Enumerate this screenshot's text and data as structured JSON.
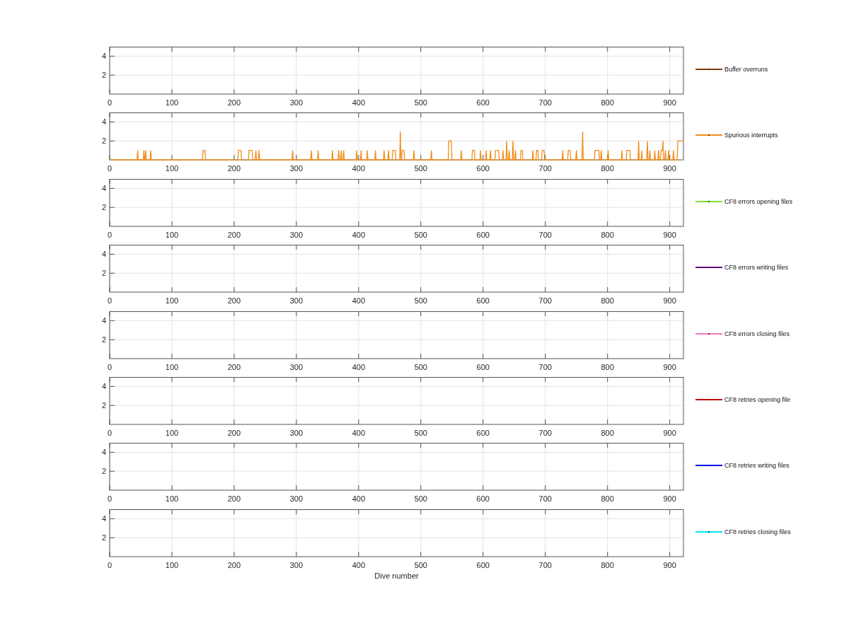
{
  "panels": [
    {
      "axes": {
        "grid": true,
        "x_tick_labels": [
          "0",
          "100",
          "200",
          "300",
          "400",
          "500",
          "600",
          "700",
          "800",
          "900"
        ],
        "y_tick_labels": [
          "4",
          "2"
        ],
        "legend": [
          {
            "label": "Buffer overruns",
            "color": "#8b3a0a"
          }
        ]
      }
    },
    {
      "chart_data": {
        "type": "line",
        "xlim": [
          0,
          922
        ],
        "ylim": [
          0,
          5
        ],
        "xticks": [
          0,
          100,
          200,
          300,
          400,
          500,
          600,
          700,
          800,
          900
        ],
        "yticks": [
          2,
          4
        ],
        "grid": true,
        "x": [
          0,
          44,
          45,
          46,
          54,
          55,
          56,
          57,
          58,
          59,
          65,
          66,
          67,
          149,
          150,
          153,
          154,
          206,
          207,
          211,
          212,
          223,
          224,
          229,
          230,
          234,
          235,
          236,
          239,
          240,
          241,
          293,
          294,
          295,
          323,
          324,
          325,
          334,
          335,
          336,
          357,
          358,
          359,
          367,
          368,
          369,
          371,
          372,
          373,
          375,
          376,
          377,
          396,
          397,
          398,
          403,
          404,
          405,
          413,
          414,
          415,
          426,
          427,
          428,
          440,
          441,
          442,
          447,
          448,
          449,
          454,
          455,
          459,
          460,
          466,
          467,
          468,
          469,
          470,
          473,
          474,
          488,
          489,
          490,
          516,
          517,
          518,
          544,
          545,
          549,
          550,
          564,
          565,
          566,
          582,
          583,
          586,
          587,
          595,
          596,
          597,
          604,
          605,
          606,
          611,
          612,
          613,
          619,
          620,
          625,
          626,
          631,
          632,
          633,
          637,
          638,
          639,
          641,
          642,
          643,
          647,
          648,
          649,
          651,
          652,
          653,
          660,
          661,
          663,
          664,
          679,
          680,
          681,
          685,
          686,
          688,
          689,
          694,
          695,
          698,
          699,
          727,
          728,
          729,
          736,
          737,
          740,
          741,
          749,
          750,
          751,
          759,
          760,
          761,
          779,
          780,
          786,
          787,
          789,
          790,
          791,
          800,
          801,
          802,
          822,
          823,
          824,
          830,
          831,
          836,
          837,
          849,
          850,
          851,
          854,
          855,
          856,
          863,
          864,
          865,
          867,
          868,
          869,
          875,
          876,
          877,
          881,
          882,
          883,
          885,
          886,
          888,
          889,
          890,
          892,
          893,
          894,
          897,
          898,
          899,
          905,
          906,
          907,
          912,
          913,
          922
        ],
        "series": [
          {
            "name": "Spurious interrupts",
            "color": "#f28e1c",
            "values": [
              0,
              0,
              1,
              0,
              0,
              1,
              0,
              0,
              1,
              0,
              0,
              1,
              0,
              0,
              1,
              1,
              0,
              0,
              1,
              1,
              0,
              0,
              1,
              1,
              0,
              0,
              1,
              0,
              0,
              1,
              0,
              0,
              1,
              0,
              0,
              1,
              0,
              0,
              1,
              0,
              0,
              1,
              0,
              0,
              1,
              0,
              0,
              1,
              0,
              0,
              1,
              0,
              0,
              1,
              0,
              0,
              1,
              0,
              0,
              1,
              0,
              0,
              1,
              0,
              0,
              1,
              0,
              0,
              1,
              0,
              0,
              1,
              1,
              0,
              0,
              3,
              0,
              0,
              1,
              1,
              0,
              0,
              1,
              0,
              0,
              1,
              0,
              0,
              2,
              2,
              0,
              0,
              1,
              0,
              0,
              1,
              1,
              0,
              0,
              1,
              0,
              0,
              1,
              0,
              0,
              1,
              0,
              0,
              1,
              1,
              0,
              0,
              1,
              0,
              0,
              2,
              0,
              0,
              1,
              0,
              0,
              2,
              0,
              0,
              1,
              0,
              0,
              1,
              1,
              0,
              0,
              1,
              0,
              0,
              1,
              1,
              0,
              0,
              1,
              1,
              0,
              0,
              1,
              0,
              0,
              1,
              1,
              0,
              0,
              1,
              0,
              0,
              3,
              0,
              0,
              1,
              1,
              0,
              0,
              1,
              0,
              0,
              1,
              0,
              0,
              1,
              0,
              0,
              1,
              1,
              0,
              0,
              2,
              0,
              0,
              1,
              0,
              0,
              2,
              0,
              0,
              1,
              0,
              0,
              1,
              0,
              0,
              1,
              0,
              0,
              1,
              1,
              2,
              0,
              0,
              1,
              0,
              0,
              1,
              0,
              0,
              1,
              0,
              0,
              2,
              2
            ]
          }
        ]
      }
    },
    {
      "axes": {
        "grid": true,
        "x_tick_labels": [
          "0",
          "100",
          "200",
          "300",
          "400",
          "500",
          "600",
          "700",
          "800",
          "900"
        ],
        "y_tick_labels": [
          "4",
          "2"
        ],
        "legend": [
          {
            "label": "CF8 errors opening files",
            "color": "#7ee02a"
          }
        ]
      }
    },
    {
      "axes": {
        "grid": true,
        "x_tick_labels": [
          "0",
          "100",
          "200",
          "300",
          "400",
          "500",
          "600",
          "700",
          "800",
          "900"
        ],
        "y_tick_labels": [
          "4",
          "2"
        ],
        "legend": [
          {
            "label": "CF8 errors writing files",
            "color": "#6a0a7e"
          }
        ]
      }
    },
    {
      "axes": {
        "grid": true,
        "x_tick_labels": [
          "0",
          "100",
          "200",
          "300",
          "400",
          "500",
          "600",
          "700",
          "800",
          "900"
        ],
        "y_tick_labels": [
          "4",
          "2"
        ],
        "legend": [
          {
            "label": "CF8 errors closing files",
            "color": "#f07ac0"
          }
        ]
      }
    },
    {
      "axes": {
        "grid": true,
        "x_tick_labels": [
          "0",
          "100",
          "200",
          "300",
          "400",
          "500",
          "600",
          "700",
          "800",
          "900"
        ],
        "y_tick_labels": [
          "4",
          "2"
        ],
        "legend": [
          {
            "label": "CF8 retries opening file",
            "color": "#cc0000"
          }
        ]
      }
    },
    {
      "axes": {
        "grid": true,
        "x_tick_labels": [
          "0",
          "100",
          "200",
          "300",
          "400",
          "500",
          "600",
          "700",
          "800",
          "900"
        ],
        "y_tick_labels": [
          "4",
          "2"
        ],
        "legend": [
          {
            "label": "CF8 retries writing files",
            "color": "#0000ee"
          }
        ]
      }
    },
    {
      "axes": {
        "grid": true,
        "x_label": "Dive number",
        "x_tick_labels": [
          "0",
          "100",
          "200",
          "300",
          "400",
          "500",
          "600",
          "700",
          "800",
          "900"
        ],
        "y_tick_labels": [
          "4",
          "2"
        ],
        "legend": [
          {
            "label": "CF8 retries closing files",
            "color": "#00e5ee"
          }
        ]
      }
    }
  ]
}
